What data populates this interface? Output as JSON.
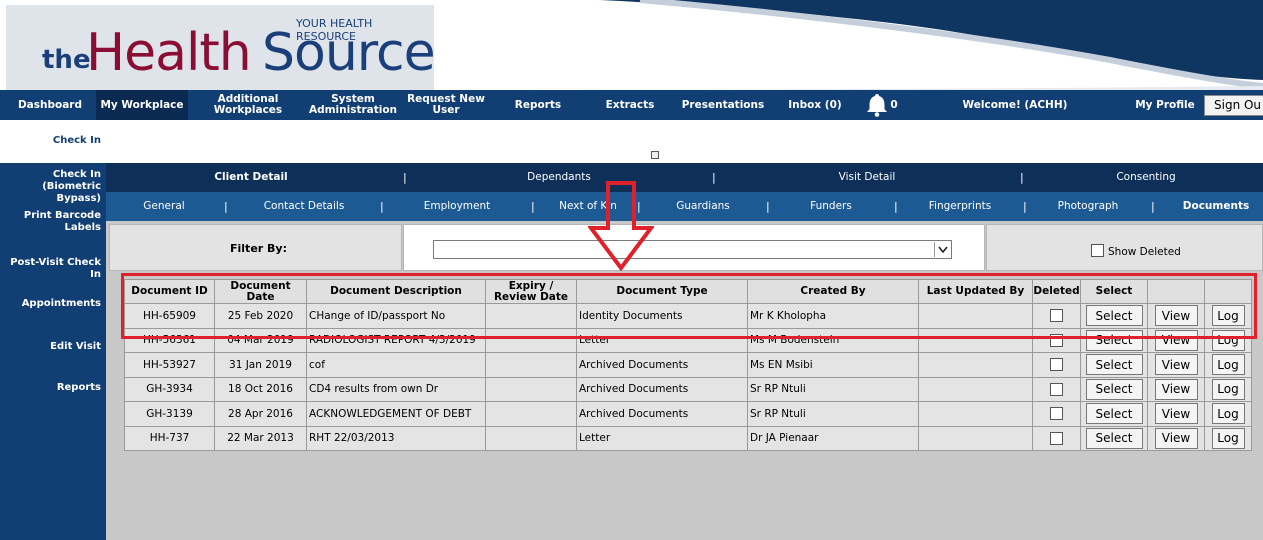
{
  "logo": {
    "tagline": "YOUR HEALTH RESOURCE",
    "the": "the",
    "health": "Health",
    "source": "Source"
  },
  "topnav": [
    {
      "label": "Dashboard"
    },
    {
      "label": "My Workplace"
    },
    {
      "label": "Additional Workplaces"
    },
    {
      "label": "System Administration"
    },
    {
      "label": "Request New User"
    },
    {
      "label": "Reports"
    },
    {
      "label": "Extracts"
    },
    {
      "label": "Presentations"
    },
    {
      "label": "Inbox (0)"
    },
    {
      "label": "0"
    },
    {
      "label": "Welcome! (ACHH)"
    },
    {
      "label": "My Profile"
    }
  ],
  "signout_label": "Sign Ou",
  "sidebar": [
    {
      "label": "Check In"
    },
    {
      "label": "Check In (Biometric Bypass)"
    },
    {
      "label": "Print Barcode Labels"
    },
    {
      "label": "Post-Visit Check In"
    },
    {
      "label": "Appointments"
    },
    {
      "label": "Edit Visit"
    },
    {
      "label": "Reports"
    }
  ],
  "tabs_primary": [
    {
      "label": "Client Detail"
    },
    {
      "label": "Dependants"
    },
    {
      "label": "Visit Detail"
    },
    {
      "label": "Consenting"
    }
  ],
  "tabs_secondary": [
    {
      "label": "General"
    },
    {
      "label": "Contact Details"
    },
    {
      "label": "Employment"
    },
    {
      "label": "Next of Kin"
    },
    {
      "label": "Guardians"
    },
    {
      "label": "Funders"
    },
    {
      "label": "Fingerprints"
    },
    {
      "label": "Photograph"
    },
    {
      "label": "Documents"
    }
  ],
  "filter": {
    "label": "Filter By:",
    "selected": "",
    "show_deleted_label": "Show Deleted",
    "show_deleted_checked": false
  },
  "table": {
    "headers": [
      "Document ID",
      "Document Date",
      "Document Description",
      "Expiry / Review Date",
      "Document Type",
      "Created By",
      "Last Updated By",
      "Deleted",
      "Select",
      "",
      ""
    ],
    "buttons": {
      "select": "Select",
      "view": "View",
      "log": "Log"
    },
    "rows": [
      {
        "id": "HH-65909",
        "date": "25 Feb 2020",
        "desc": "CHange of ID/passport No",
        "expiry": "",
        "type": "Identity Documents",
        "created_by": "Mr K Kholopha",
        "updated_by": ""
      },
      {
        "id": "HH-56361",
        "date": "04 Mar 2019",
        "desc": "RADIOLOGIST REPORT 4/3/2019",
        "expiry": "",
        "type": "Letter",
        "created_by": "Ms M Bodenstein",
        "updated_by": ""
      },
      {
        "id": "HH-53927",
        "date": "31 Jan 2019",
        "desc": "cof",
        "expiry": "",
        "type": "Archived Documents",
        "created_by": "Ms EN Msibi",
        "updated_by": ""
      },
      {
        "id": "GH-3934",
        "date": "18 Oct 2016",
        "desc": "CD4 results from own Dr",
        "expiry": "",
        "type": "Archived Documents",
        "created_by": "Sr RP Ntuli",
        "updated_by": ""
      },
      {
        "id": "GH-3139",
        "date": "28 Apr 2016",
        "desc": "ACKNOWLEDGEMENT OF DEBT",
        "expiry": "",
        "type": "Archived Documents",
        "created_by": "Sr RP Ntuli",
        "updated_by": ""
      },
      {
        "id": "HH-737",
        "date": "22 Mar 2013",
        "desc": "RHT 22/03/2013",
        "expiry": "",
        "type": "Letter",
        "created_by": "Dr JA Pienaar",
        "updated_by": ""
      }
    ]
  },
  "colors": {
    "nav": "#123f73",
    "nav_active": "#0b2a52",
    "tab_primary": "#0d2f58",
    "tab_secondary": "#1d5a93",
    "brand_red": "#8a0d33",
    "annotation": "#e0202a"
  },
  "annotations": {
    "highlight_row": 0,
    "arrow": "down-arrow-annotation"
  }
}
